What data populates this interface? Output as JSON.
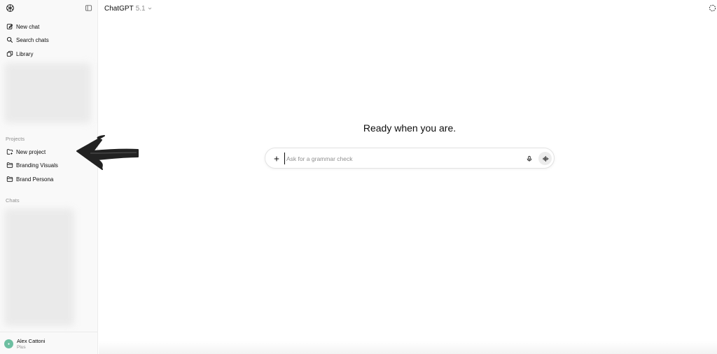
{
  "sidebar": {
    "nav": [
      {
        "label": "New chat",
        "icon": "edit-icon"
      },
      {
        "label": "Search chats",
        "icon": "search-icon"
      },
      {
        "label": "Library",
        "icon": "library-icon"
      }
    ],
    "projects_label": "Projects",
    "projects": [
      {
        "label": "New project",
        "icon": "folder-plus-icon"
      },
      {
        "label": "Branding Visuals",
        "icon": "folder-icon"
      },
      {
        "label": "Brand Persona",
        "icon": "folder-icon"
      }
    ],
    "chats_label": "Chats",
    "user": {
      "name": "Alex Cattoni",
      "plan": "Plus",
      "avatar_color": "#6dbfa1"
    }
  },
  "header": {
    "model_name": "ChatGPT",
    "model_version": "5.1"
  },
  "main": {
    "heading": "Ready when you are.",
    "composer": {
      "placeholder": "Ask for a grammar check"
    }
  },
  "colors": {
    "sidebar_bg": "#f9f9f9",
    "muted_text": "#8f8f8f",
    "annotation_arrow": "#222222"
  }
}
